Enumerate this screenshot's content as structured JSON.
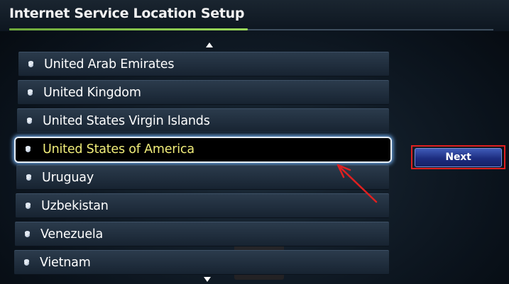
{
  "screen": {
    "title": "Internet Service Location Setup"
  },
  "countries": [
    {
      "label": "United Arab Emirates",
      "selected": false
    },
    {
      "label": "United Kingdom",
      "selected": false
    },
    {
      "label": "United States Virgin Islands",
      "selected": false
    },
    {
      "label": "United States of America",
      "selected": true
    },
    {
      "label": "Uruguay",
      "selected": false
    },
    {
      "label": "Uzbekistan",
      "selected": false
    },
    {
      "label": "Venezuela",
      "selected": false
    },
    {
      "label": "Vietnam",
      "selected": false
    }
  ],
  "actions": {
    "next_label": "Next"
  },
  "icons": {
    "scroll_up": "chevron-up-icon",
    "scroll_down": "chevron-down-icon",
    "bullet": "bullet-icon"
  },
  "colors": {
    "selected_text": "#f1ed7a",
    "selection_glow": "#78b9ff",
    "progress_accent": "#8cc84b",
    "annotation": "#e02020",
    "button_fill": "#1d2d80"
  }
}
